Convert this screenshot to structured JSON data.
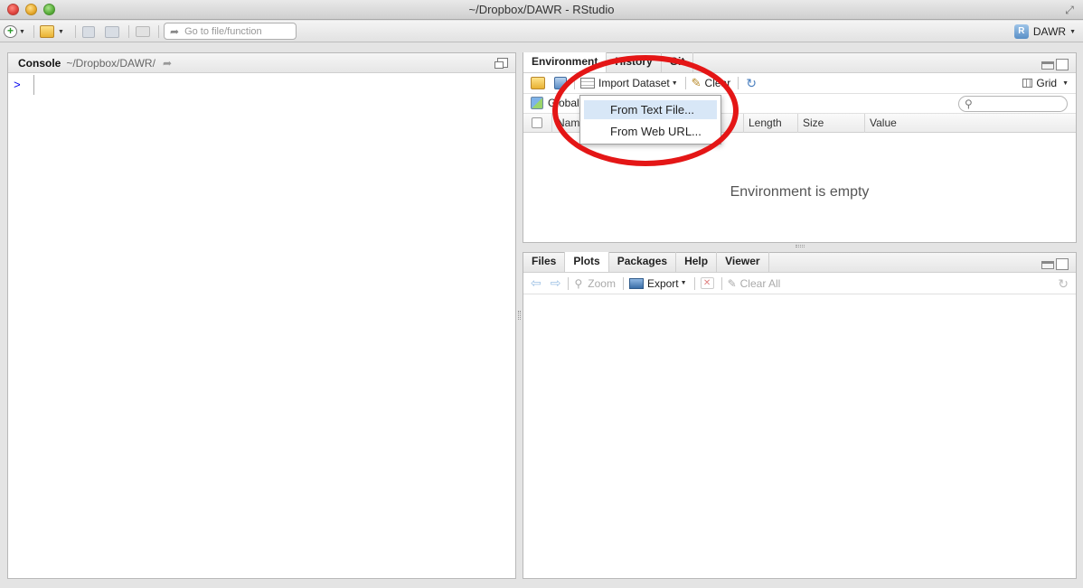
{
  "window": {
    "title": "~/Dropbox/DAWR - RStudio"
  },
  "toolbar": {
    "goto_placeholder": "Go to file/function",
    "project_label": "DAWR"
  },
  "console": {
    "title": "Console",
    "path": "~/Dropbox/DAWR/",
    "prompt": ">"
  },
  "env_pane": {
    "tabs": [
      "Environment",
      "History",
      "Git"
    ],
    "import_label": "Import Dataset",
    "clear_label": "Clear",
    "grid_label": "Grid",
    "global_label": "Global",
    "columns": [
      "Name",
      "Length",
      "Size",
      "Value"
    ],
    "empty_message": "Environment is empty"
  },
  "import_menu": {
    "items": [
      "From Text File...",
      "From Web URL..."
    ]
  },
  "files_pane": {
    "tabs": [
      "Files",
      "Plots",
      "Packages",
      "Help",
      "Viewer"
    ],
    "zoom_label": "Zoom",
    "export_label": "Export",
    "clear_all_label": "Clear All"
  },
  "colors": {
    "annotation_circle": "#e41616",
    "menu_highlight": "#d8e7f7",
    "prompt": "#0000ee"
  }
}
